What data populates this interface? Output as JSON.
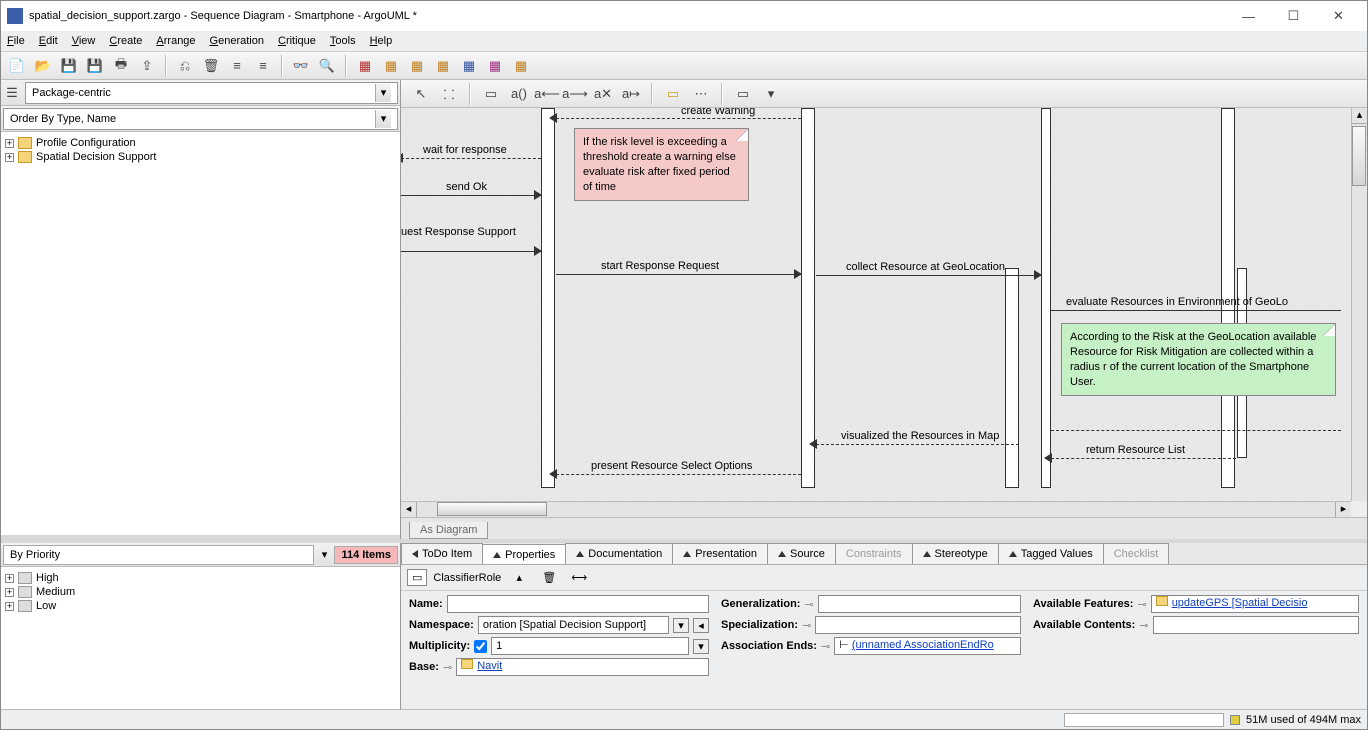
{
  "window": {
    "title": "spatial_decision_support.zargo - Sequence Diagram - Smartphone - ArgoUML *"
  },
  "menu": {
    "items": [
      "File",
      "Edit",
      "View",
      "Create",
      "Arrange",
      "Generation",
      "Critique",
      "Tools",
      "Help"
    ]
  },
  "left": {
    "perspective": "Package-centric",
    "order": "Order By Type, Name",
    "nodes": [
      {
        "label": "Profile Configuration"
      },
      {
        "label": "Spatial Decision Support"
      }
    ]
  },
  "todo": {
    "by": "By Priority",
    "count": "114 Items",
    "levels": [
      "High",
      "Medium",
      "Low"
    ]
  },
  "diagram": {
    "tab": "As Diagram",
    "messages": {
      "createWarning": "create Warning",
      "waitForResponse": "wait for response",
      "sendOk": "send Ok",
      "uestResponseSupport": "uest Response Support",
      "startResponseRequest": "start Response Request",
      "collectResource": "collect Resource at GeoLocation",
      "evaluateResources": "evaluate Resources in Environment of GeoLo",
      "visualizedResources": "visualized the Resources in Map",
      "returnResourceList": "return Resource List",
      "presentResource": "present Resource Select Options"
    },
    "notePink": "If the risk level is exceeding a threshold create a warning else evaluate risk after fixed period of time",
    "noteGreen": "According to the Risk at the GeoLocation available Resource for Risk Mitigation are collected within a radius r of the current location of the Smartphone User."
  },
  "props": {
    "tabs": {
      "todo": "ToDo Item",
      "properties": "Properties",
      "documentation": "Documentation",
      "presentation": "Presentation",
      "source": "Source",
      "constraints": "Constraints",
      "stereotype": "Stereotype",
      "tagged": "Tagged Values",
      "checklist": "Checklist"
    },
    "heading": "ClassifierRole",
    "labels": {
      "name": "Name:",
      "namespace": "Namespace:",
      "multiplicity": "Multiplicity:",
      "base": "Base:",
      "generalization": "Generalization:",
      "specialization": "Specialization:",
      "assocEnds": "Association Ends:",
      "availFeatures": "Available Features:",
      "availContents": "Available Contents:"
    },
    "values": {
      "name": "",
      "namespace": "oration [Spatial Decision Support]",
      "multiplicity": "1",
      "base": "Navit",
      "assocEnd": "(unnamed AssociationEndRo",
      "feature": "updateGPS [Spatial Decisio"
    }
  },
  "status": {
    "mem": "51M used of 494M max"
  }
}
